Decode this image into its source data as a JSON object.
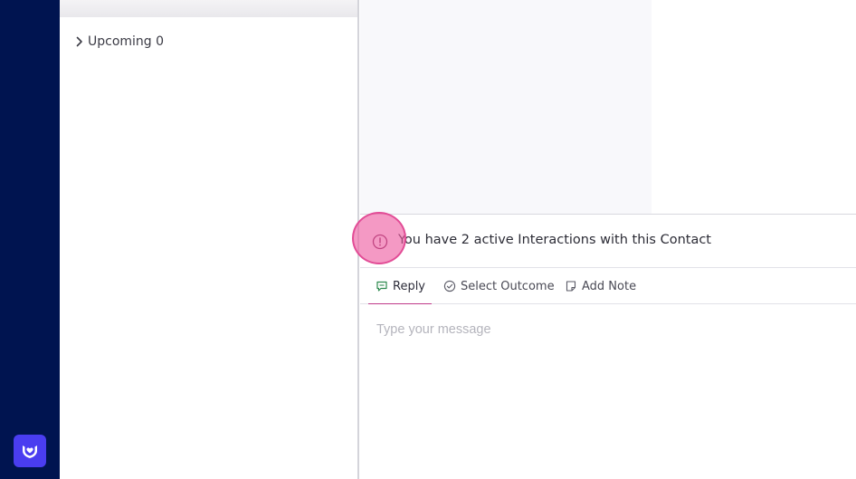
{
  "sidebar": {
    "logo_icon": "hands-heart-icon",
    "background": "#001450",
    "logo_color": "#4a3df0"
  },
  "left_panel": {
    "upcoming_label": "Upcoming 0"
  },
  "notice": {
    "icon": "info-circle-icon",
    "text": "You have 2 active Interactions with this Contact"
  },
  "tabs": [
    {
      "label": "Reply",
      "icon": "chat-bubble-icon",
      "active": true
    },
    {
      "label": "Select Outcome",
      "icon": "check-circle-icon",
      "active": false
    },
    {
      "label": "Add Note",
      "icon": "note-icon",
      "active": false
    }
  ],
  "composer": {
    "placeholder": "Type your message",
    "value": ""
  },
  "colors": {
    "accent": "#c03a8a",
    "highlight": "#ee5aa0"
  }
}
